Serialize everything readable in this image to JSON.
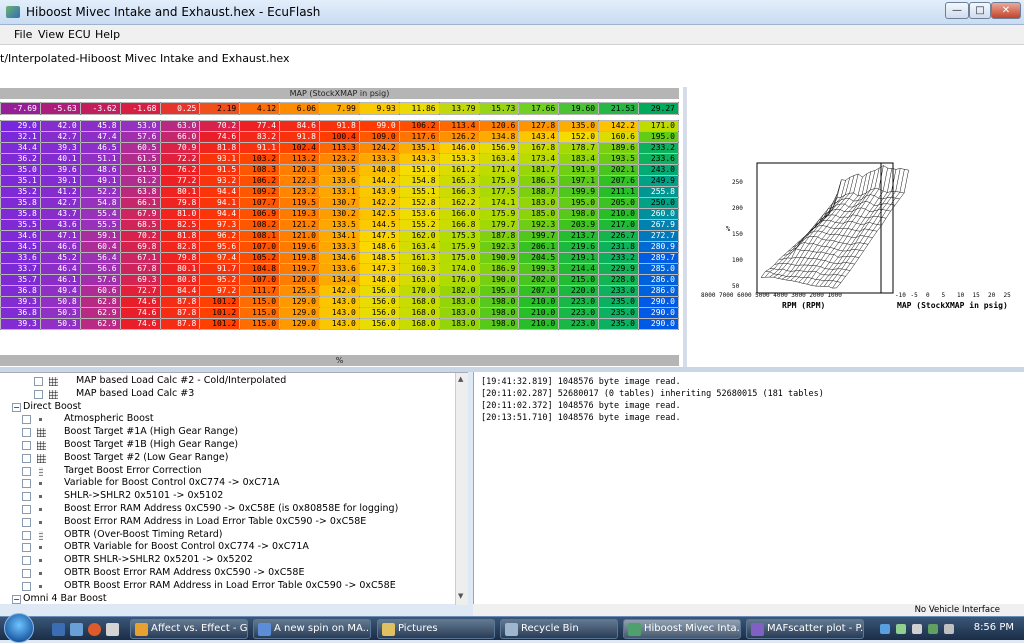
{
  "window": {
    "title": "Hiboost Mivec Intake and Exhaust.hex - EcuFlash",
    "min": "—",
    "max": "□",
    "close": "✕"
  },
  "menu": [
    "File",
    "View",
    "ECU",
    "Help"
  ],
  "path": "t/Interpolated-Hiboost Mivec Intake and Exhaust.hex",
  "table": {
    "title": "MAP (StockXMAP in psig)",
    "footer": "%",
    "x_axis": [
      "-7.69",
      "-5.63",
      "-3.62",
      "-1.68",
      "0.25",
      "2.19",
      "4.12",
      "6.06",
      "7.99",
      "9.93",
      "11.86",
      "13.79",
      "15.73",
      "17.66",
      "19.60",
      "21.53",
      "29.27"
    ],
    "rows": [
      [
        "29.0",
        "42.0",
        "45.8",
        "53.0",
        "63.0",
        "70.2",
        "77.4",
        "84.6",
        "91.8",
        "99.0",
        "106.2",
        "113.4",
        "120.6",
        "127.8",
        "135.0",
        "142.2",
        "171.0"
      ],
      [
        "32.1",
        "42.7",
        "47.4",
        "57.6",
        "66.0",
        "74.6",
        "83.2",
        "91.8",
        "100.4",
        "109.0",
        "117.6",
        "126.2",
        "134.8",
        "143.4",
        "152.0",
        "160.6",
        "195.0"
      ],
      [
        "34.4",
        "39.3",
        "46.5",
        "60.5",
        "70.9",
        "81.8",
        "91.1",
        "102.4",
        "113.3",
        "124.2",
        "135.1",
        "146.0",
        "156.9",
        "167.8",
        "178.7",
        "189.6",
        "233.2"
      ],
      [
        "36.2",
        "40.1",
        "51.1",
        "61.5",
        "72.2",
        "93.1",
        "103.2",
        "113.2",
        "123.2",
        "133.3",
        "143.3",
        "153.3",
        "163.4",
        "173.4",
        "183.4",
        "193.5",
        "233.6"
      ],
      [
        "35.0",
        "39.6",
        "48.6",
        "61.9",
        "76.2",
        "91.5",
        "108.3",
        "120.3",
        "130.5",
        "140.8",
        "151.0",
        "161.2",
        "171.4",
        "181.7",
        "191.9",
        "202.1",
        "243.0"
      ],
      [
        "35.1",
        "39.1",
        "49.1",
        "61.2",
        "77.2",
        "93.2",
        "106.2",
        "122.3",
        "133.6",
        "144.2",
        "154.8",
        "165.3",
        "175.9",
        "186.5",
        "197.1",
        "207.6",
        "249.9"
      ],
      [
        "35.2",
        "41.2",
        "52.2",
        "63.8",
        "80.1",
        "94.4",
        "109.2",
        "123.2",
        "133.1",
        "143.9",
        "155.1",
        "166.3",
        "177.5",
        "188.7",
        "199.9",
        "211.1",
        "255.8"
      ],
      [
        "35.8",
        "42.7",
        "54.8",
        "66.1",
        "79.8",
        "94.1",
        "107.7",
        "119.5",
        "130.7",
        "142.2",
        "152.8",
        "162.2",
        "174.1",
        "183.0",
        "195.0",
        "205.0",
        "250.0"
      ],
      [
        "35.8",
        "43.7",
        "55.4",
        "67.9",
        "81.0",
        "94.4",
        "106.9",
        "119.3",
        "130.2",
        "142.5",
        "153.6",
        "166.0",
        "175.9",
        "185.0",
        "198.0",
        "210.0",
        "260.0"
      ],
      [
        "35.5",
        "43.6",
        "55.5",
        "68.5",
        "82.5",
        "97.3",
        "108.2",
        "121.2",
        "133.5",
        "144.5",
        "155.2",
        "166.8",
        "179.7",
        "192.3",
        "203.9",
        "217.0",
        "267.9"
      ],
      [
        "34.6",
        "47.1",
        "59.1",
        "70.2",
        "81.8",
        "96.2",
        "108.1",
        "121.0",
        "134.1",
        "147.5",
        "162.0",
        "175.3",
        "187.8",
        "199.7",
        "213.7",
        "226.7",
        "272.7"
      ],
      [
        "34.5",
        "46.6",
        "60.4",
        "69.8",
        "82.8",
        "95.6",
        "107.0",
        "119.6",
        "133.3",
        "148.6",
        "163.4",
        "175.9",
        "192.3",
        "206.1",
        "219.6",
        "231.8",
        "280.9"
      ],
      [
        "33.6",
        "45.2",
        "56.4",
        "67.1",
        "79.8",
        "97.4",
        "105.2",
        "119.8",
        "134.6",
        "148.5",
        "161.3",
        "175.0",
        "190.9",
        "204.5",
        "219.1",
        "233.2",
        "289.7"
      ],
      [
        "33.7",
        "46.4",
        "56.6",
        "67.8",
        "80.1",
        "91.7",
        "104.8",
        "119.7",
        "133.6",
        "147.3",
        "160.3",
        "174.0",
        "186.9",
        "199.3",
        "214.4",
        "229.9",
        "285.0"
      ],
      [
        "35.7",
        "46.1",
        "57.6",
        "69.3",
        "80.8",
        "95.2",
        "107.0",
        "120.0",
        "134.4",
        "148.0",
        "163.0",
        "176.0",
        "190.0",
        "202.0",
        "215.0",
        "228.0",
        "286.0"
      ],
      [
        "36.8",
        "49.4",
        "60.6",
        "72.7",
        "84.4",
        "97.2",
        "111.7",
        "125.5",
        "142.0",
        "156.0",
        "170.0",
        "182.0",
        "195.0",
        "207.0",
        "220.0",
        "233.0",
        "286.0"
      ],
      [
        "39.3",
        "50.8",
        "62.8",
        "74.6",
        "87.8",
        "101.2",
        "115.0",
        "129.0",
        "143.0",
        "156.0",
        "168.0",
        "183.0",
        "198.0",
        "210.0",
        "223.0",
        "235.0",
        "290.0"
      ],
      [
        "36.8",
        "50.3",
        "62.9",
        "74.6",
        "87.8",
        "101.2",
        "115.0",
        "129.0",
        "143.0",
        "156.0",
        "168.0",
        "183.0",
        "198.0",
        "210.0",
        "223.0",
        "235.0",
        "290.0"
      ],
      [
        "39.3",
        "50.3",
        "62.9",
        "74.6",
        "87.8",
        "101.2",
        "115.0",
        "129.0",
        "143.0",
        "156.0",
        "168.0",
        "183.0",
        "198.0",
        "210.0",
        "223.0",
        "235.0",
        "290.0"
      ]
    ],
    "colors": {
      "low": "#8a2be2",
      "mid": "#ff2a00",
      "high": "#0055ff"
    }
  },
  "graph": {
    "y_ticks": [
      "250",
      "200",
      "150",
      "100",
      "50"
    ],
    "y_label": "%",
    "x_label": "RPM (RPM)",
    "x_ticks": "8000 7000 6000 5000 4000 3000 2000 1000",
    "z_label": "MAP (StockXMAP in psig)",
    "z_ticks": [
      "-10",
      "-5",
      "0",
      "5",
      "10",
      "15",
      "20",
      "25"
    ]
  },
  "tree": {
    "items": [
      {
        "label": "MAP based Load Calc #2 - Cold/Interpolated",
        "level": 2,
        "icon": "table-icon"
      },
      {
        "label": "MAP based Load Calc #3",
        "level": 2,
        "icon": "table-icon"
      },
      {
        "label": "Direct Boost",
        "level": 0,
        "icon": "category"
      },
      {
        "label": "Atmospheric Boost",
        "level": 1,
        "icon": "value-icon"
      },
      {
        "label": "Boost Target #1A (High Gear Range)",
        "level": 1,
        "icon": "table-icon"
      },
      {
        "label": "Boost Target #1B (High Gear Range)",
        "level": 1,
        "icon": "table-icon"
      },
      {
        "label": "Boost Target #2 (Low Gear Range)",
        "level": 1,
        "icon": "table-icon"
      },
      {
        "label": "Target Boost Error Correction",
        "level": 1,
        "icon": "column-icon"
      },
      {
        "label": "Variable for Boost Control 0xC774 -> 0xC71A",
        "level": 1,
        "icon": "value-icon"
      },
      {
        "label": "SHLR->SHLR2 0x5101 -> 0x5102",
        "level": 1,
        "icon": "value-icon"
      },
      {
        "label": "Boost Error RAM Address 0xC590 -> 0xC58E (is 0x80858E for logging)",
        "level": 1,
        "icon": "value-icon"
      },
      {
        "label": "Boost Error RAM Address in Load Error Table 0xC590 -> 0xC58E",
        "level": 1,
        "icon": "value-icon"
      },
      {
        "label": "OBTR (Over-Boost Timing Retard)",
        "level": 1,
        "icon": "column-icon"
      },
      {
        "label": "OBTR Variable for Boost Control 0xC774 -> 0xC71A",
        "level": 1,
        "icon": "value-icon"
      },
      {
        "label": "OBTR SHLR->SHLR2 0x5201 -> 0x5202",
        "level": 1,
        "icon": "value-icon"
      },
      {
        "label": "OBTR Boost Error RAM Address 0xC590 -> 0xC58E",
        "level": 1,
        "icon": "value-icon"
      },
      {
        "label": "OBTR Boost Error RAM Address in Load Error Table 0xC590 -> 0xC58E",
        "level": 1,
        "icon": "value-icon"
      },
      {
        "label": "Omni 4 Bar Boost",
        "level": 0,
        "icon": "category"
      }
    ]
  },
  "log": [
    "[19:41:32.819] 1048576 byte image read.",
    "[20:11:02.287] 52680017 (0 tables) inheriting 52680015 (181 tables)",
    "[20:11:02.372] 1048576 byte image read.",
    "[20:13:51.710] 1048576 byte image read."
  ],
  "status": "No Vehicle Interface",
  "taskbar": {
    "tasks": [
      {
        "label": "Affect vs. Effect - G...",
        "color": "#e8a030"
      },
      {
        "label": "A new spin on MA...",
        "color": "#5b8ed6"
      },
      {
        "label": "Pictures",
        "color": "#e0c060"
      },
      {
        "label": "Recycle Bin",
        "color": "#9fb6cf"
      },
      {
        "label": "Hiboost Mivec Inta...",
        "color": "#4f9f6f"
      },
      {
        "label": "MAFscatter plot - P...",
        "color": "#8060c0"
      }
    ],
    "clock": "8:56 PM"
  }
}
